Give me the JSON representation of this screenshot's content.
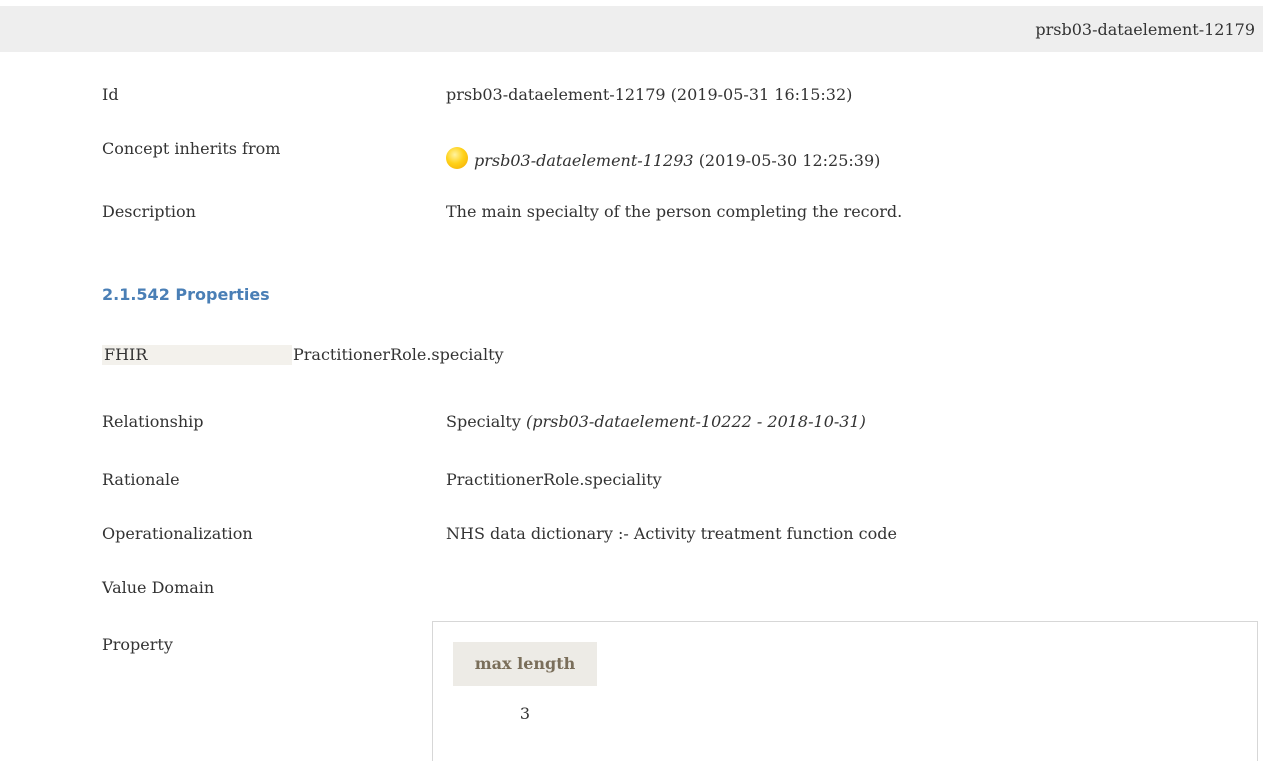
{
  "header": {
    "element_id": "prsb03-dataelement-12179"
  },
  "details": {
    "id": {
      "label": "Id",
      "value": "prsb03-dataelement-12179 (2019-05-31 16:15:32)"
    },
    "inherits": {
      "label": "Concept inherits from",
      "link": "prsb03-dataelement-11293",
      "date": "(2019-05-30 12:25:39)",
      "icon": "yellow-status-dot-icon"
    },
    "description": {
      "label": "Description",
      "value": "The main specialty of the person completing the record."
    }
  },
  "properties_heading": "2.1.542 Properties",
  "fhir": {
    "label": "FHIR",
    "value": "PractitionerRole.specialty"
  },
  "relationship": {
    "label": "Relationship",
    "value": "Specialty",
    "ref": "(prsb03-dataelement-10222 - 2018-10-31)"
  },
  "rationale": {
    "label": "Rationale",
    "value": "PractitionerRole.speciality"
  },
  "operationalization": {
    "label": "Operationalization",
    "value": "NHS data dictionary :- Activity treatment function code"
  },
  "value_domain": {
    "label": "Value Domain"
  },
  "property": {
    "label": "Property",
    "column": "max length",
    "value": "3"
  },
  "colors": {
    "heading": "#4a7fb6",
    "status_dot": "#ffd21a",
    "topbar": "#eeeeee"
  }
}
